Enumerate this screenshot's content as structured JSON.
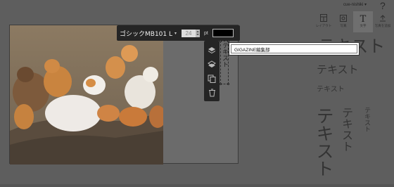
{
  "header": {
    "user_name": "cue-nishiki ▾",
    "help_glyph": "?"
  },
  "tool_tabs": [
    {
      "label": "レイアウト",
      "icon": "layout-icon"
    },
    {
      "label": "写真",
      "icon": "photo-icon"
    },
    {
      "label": "文字",
      "icon": "text-icon",
      "active": true
    },
    {
      "label": "写真を追加",
      "icon": "upload-icon"
    }
  ],
  "text_samples": {
    "large": "テキスト",
    "medium": "テキスト",
    "small": "テキスト",
    "vertical_large": "テキスト",
    "vertical_medium": "テキスト",
    "vertical_small": "テキスト"
  },
  "font_toolbar": {
    "font_name": "ゴシックMB101 L",
    "caret": "▾",
    "size_value": "24",
    "size_unit": "pt",
    "color": "#000000"
  },
  "side_tools": [
    {
      "icon": "bring-forward-icon"
    },
    {
      "icon": "send-backward-icon"
    },
    {
      "icon": "duplicate-icon"
    },
    {
      "icon": "trash-icon"
    }
  ],
  "canvas": {
    "vertical_text": "テキスト"
  },
  "text_input": {
    "value": "GIGAZINE編集部"
  }
}
